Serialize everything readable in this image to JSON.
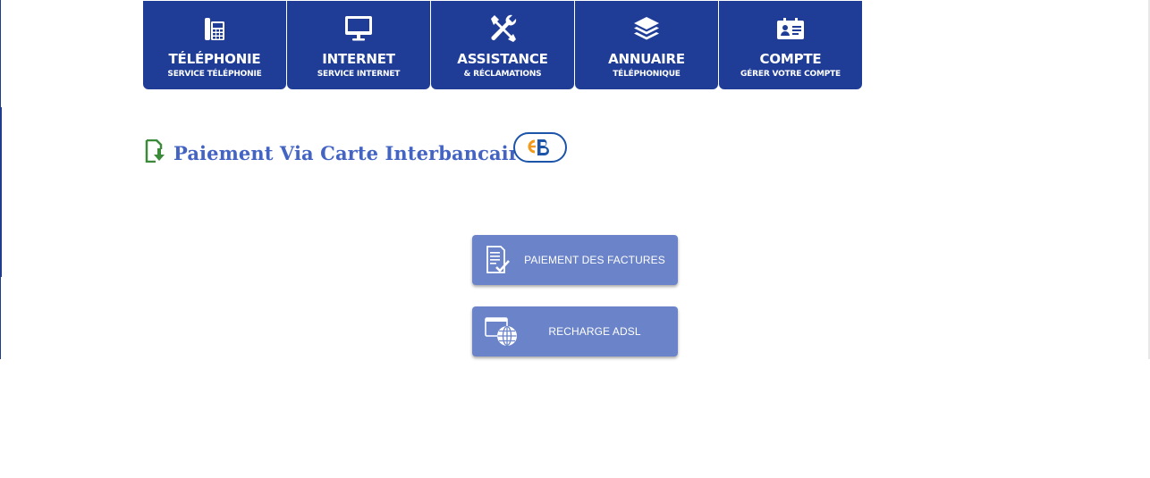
{
  "nav": {
    "items": [
      {
        "title": "TÉLÉPHONIE",
        "subtitle": "SERVICE TÉLÉPHONIE",
        "icon": "desk-phone-icon"
      },
      {
        "title": "INTERNET",
        "subtitle": "SERVICE INTERNET",
        "icon": "monitor-icon"
      },
      {
        "title": "ASSISTANCE",
        "subtitle": "& RÉCLAMATIONS",
        "icon": "tools-icon"
      },
      {
        "title": "ANNUAIRE",
        "subtitle": "TÉLÉPHONIQUE",
        "icon": "layers-icon"
      },
      {
        "title": "COMPTE",
        "subtitle": "GÉRER VOTRE COMPTE",
        "icon": "id-card-icon"
      }
    ]
  },
  "section": {
    "title": "Paiement Via Carte Interbancaire",
    "icon": "download-document-icon",
    "logo": "cb-logo"
  },
  "actions": {
    "pay_bills_label": "PAIEMENT DES FACTURES",
    "pay_bills_icon": "invoice-check-icon",
    "adsl_label": "RECHARGE ADSL",
    "adsl_icon": "web-globe-icon"
  },
  "colors": {
    "nav_bg": "#1f3d97",
    "title": "#4464c4",
    "button_bg": "#6b84c9",
    "section_icon": "#3a8a3a"
  }
}
